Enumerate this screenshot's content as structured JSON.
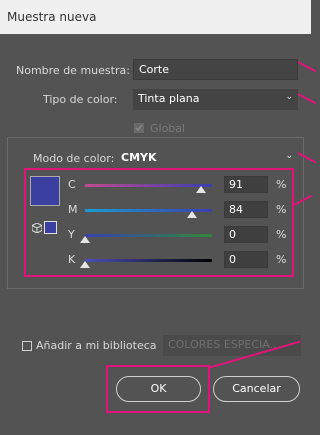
{
  "window": {
    "title": "Muestra nueva"
  },
  "form": {
    "name_label": "Nombre de muestra:",
    "name_value": "Corte",
    "type_label": "Tipo de color:",
    "type_value": "Tinta plana",
    "global_label": "Global",
    "mode_label": "Modo de color:",
    "mode_value": "CMYK"
  },
  "sliders": [
    {
      "label": "C",
      "value": "91",
      "unit": "%",
      "fraction": 0.91,
      "color_from": "#c14a8f",
      "color_to": "#3a3fb0"
    },
    {
      "label": "M",
      "value": "84",
      "unit": "%",
      "fraction": 0.84,
      "color_from": "#1b9bd3",
      "color_to": "#3a3fb0"
    },
    {
      "label": "Y",
      "value": "0",
      "unit": "%",
      "fraction": 0.0,
      "color_from": "#3a3fb0",
      "color_to": "#2f8a3a"
    },
    {
      "label": "K",
      "value": "0",
      "unit": "%",
      "fraction": 0.0,
      "color_from": "#4a4fb8",
      "color_to": "#000000"
    }
  ],
  "swatch_color": "#3a3fa0",
  "library": {
    "add_label": "Añadir a mi biblioteca",
    "select_placeholder": "COLORES ESPECIA..."
  },
  "buttons": {
    "ok": "OK",
    "cancel": "Cancelar"
  },
  "accent_color": "#e0147a"
}
